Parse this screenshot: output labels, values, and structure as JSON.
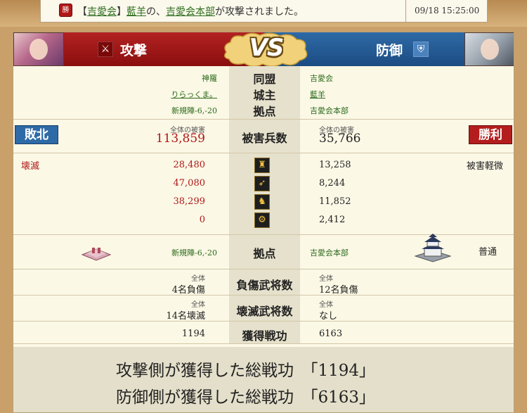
{
  "notice": {
    "badge": "勝",
    "bracket_open": "【",
    "alliance": "吉愛会",
    "bracket_close": "】",
    "lord": "藍羊",
    "mid": "の、",
    "base": "吉愛会本部",
    "suffix": "が攻撃されました。",
    "time": "09/18 15:25:00"
  },
  "header": {
    "attack_label": "攻撃",
    "defense_label": "防御",
    "vs": "VS"
  },
  "info": {
    "alliance_label": "同盟",
    "attacker_alliance": "神羅",
    "defender_alliance": "吉愛会",
    "lord_label": "城主",
    "attacker_lord": "りらっくま。",
    "defender_lord": "藍羊",
    "base_label": "拠点",
    "attacker_base": "新規陣-6,-20",
    "defender_base": "吉愛会本部"
  },
  "damage": {
    "label": "被害兵数",
    "attacker_result": "敗北",
    "defender_result": "勝利",
    "attacker_total_label": "全体の被害",
    "attacker_total": "113,859",
    "defender_total_label": "全体の被害",
    "defender_total": "35,766",
    "attacker_status": "壊滅",
    "defender_status": "被害軽微",
    "units": [
      {
        "icon": "spear-unit-icon",
        "attacker": "28,480",
        "defender": "13,258"
      },
      {
        "icon": "bow-unit-icon",
        "attacker": "47,080",
        "defender": "8,244"
      },
      {
        "icon": "cavalry-unit-icon",
        "attacker": "38,299",
        "defender": "11,852"
      },
      {
        "icon": "siege-unit-icon",
        "attacker": "0",
        "defender": "2,412"
      }
    ]
  },
  "base_row": {
    "label": "拠点",
    "attacker_base": "新規陣-6,-20",
    "defender_base": "吉愛会本部",
    "defender_state": "普通"
  },
  "injured": {
    "label": "負傷武将数",
    "attacker_small": "全体",
    "attacker_value": "4名負傷",
    "defender_small": "全体",
    "defender_value": "12名負傷"
  },
  "destroyed": {
    "label": "壊滅武将数",
    "attacker_small": "全体",
    "attacker_value": "14名壊滅",
    "defender_small": "全体",
    "defender_value": "なし"
  },
  "merit": {
    "label": "獲得戦功",
    "attacker": "1194",
    "defender": "6163"
  },
  "footer": {
    "line1": "攻撃側が獲得した総戦功　「1194」",
    "line2": "防御側が獲得した総戦功　「6163」"
  },
  "colors": {
    "attack_red": "#b01818",
    "defense_blue": "#2e6aa6",
    "link_green": "#2c6a1a"
  }
}
